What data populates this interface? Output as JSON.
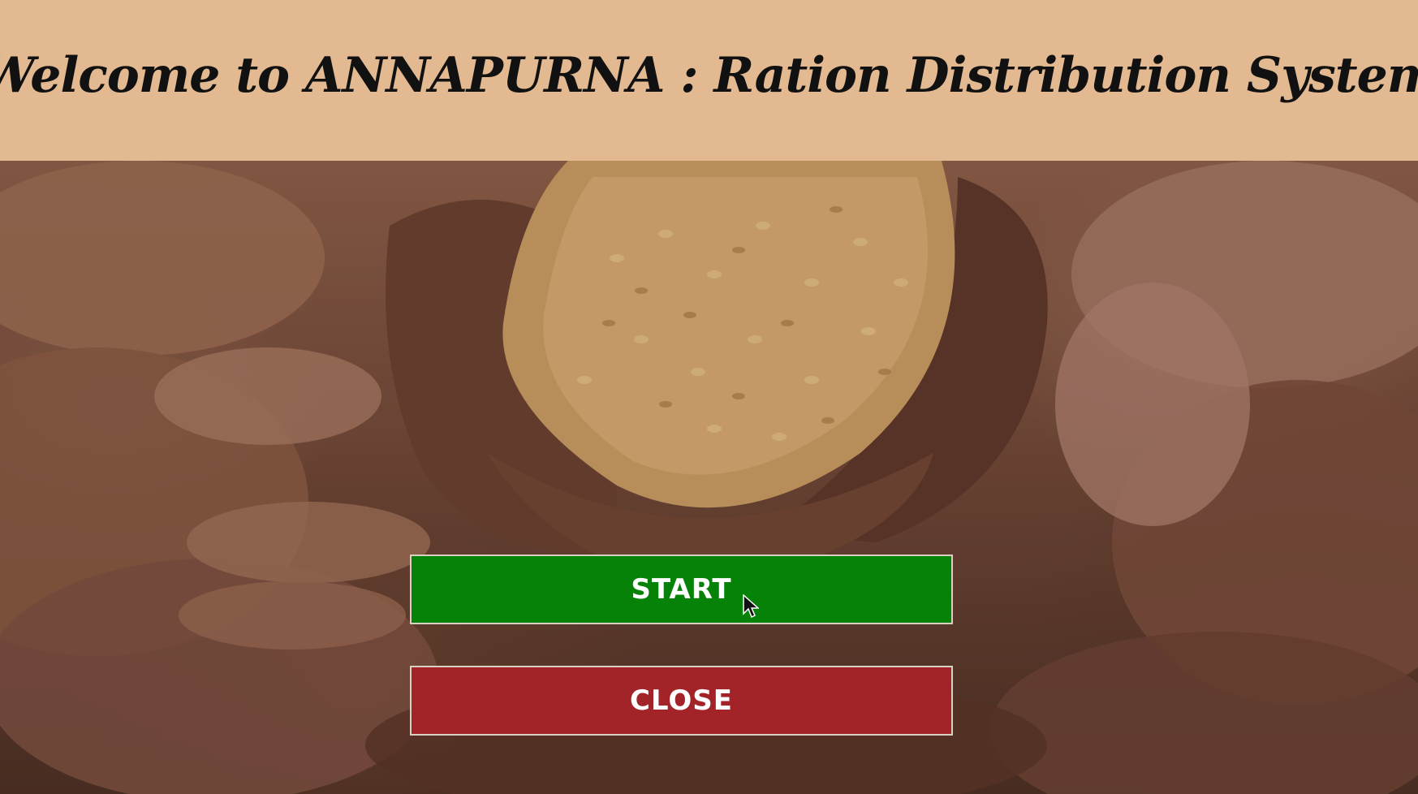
{
  "app": {
    "title": "Welcome to ANNAPURNA : Ration Distribution System"
  },
  "buttons": {
    "start_label": "START",
    "close_label": "CLOSE"
  },
  "colors": {
    "header_bg": "#e2b990",
    "start_bg": "#078208",
    "close_bg": "#a32428",
    "button_text": "#ffffff"
  },
  "background_image": {
    "subject": "hands-holding-wheat-grains-photo"
  },
  "cursor": {
    "icon": "mouse-pointer-icon"
  }
}
